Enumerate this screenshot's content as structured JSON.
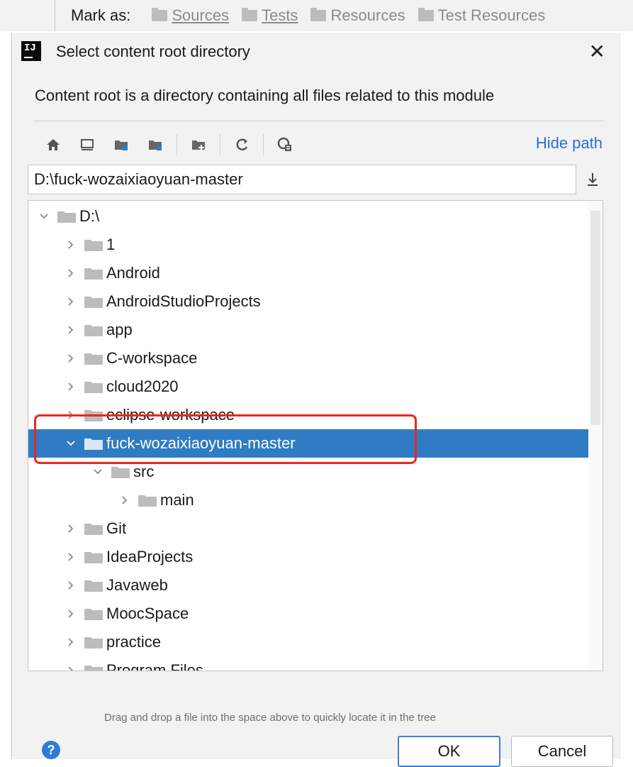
{
  "mark_bar": {
    "label": "Mark as:",
    "items": [
      {
        "label": "Sources",
        "icon": "sources-folder-icon"
      },
      {
        "label": "Tests",
        "icon": "tests-folder-icon"
      },
      {
        "label": "Resources",
        "icon": "resources-folder-icon"
      },
      {
        "label": "Test Resources",
        "icon": "test-resources-folder-icon"
      }
    ]
  },
  "dialog": {
    "title": "Select content root directory",
    "description": "Content root is a directory containing all files related to this module",
    "hide_path_label": "Hide path",
    "path_value": "D:\\fuck-wozaixiaoyuan-master",
    "hint": "Drag and drop a file into the space above to quickly locate it in the tree",
    "ok_label": "OK",
    "cancel_label": "Cancel",
    "help_label": "?"
  },
  "toolbar": {
    "buttons": [
      "home-icon",
      "desktop-icon",
      "project-folder-icon",
      "module-folder-icon",
      "new-folder-icon",
      "refresh-icon",
      "show-hidden-icon"
    ]
  },
  "tree": {
    "rows": [
      {
        "label": "D:\\",
        "expanded": true,
        "level": 0
      },
      {
        "label": "1",
        "expanded": false,
        "level": 1
      },
      {
        "label": "Android",
        "expanded": false,
        "level": 1
      },
      {
        "label": "AndroidStudioProjects",
        "expanded": false,
        "level": 1
      },
      {
        "label": "app",
        "expanded": false,
        "level": 1
      },
      {
        "label": "C-workspace",
        "expanded": false,
        "level": 1
      },
      {
        "label": "cloud2020",
        "expanded": false,
        "level": 1
      },
      {
        "label": "eclipse-workspace",
        "expanded": false,
        "level": 1
      },
      {
        "label": "fuck-wozaixiaoyuan-master",
        "expanded": true,
        "level": 1,
        "selected": true
      },
      {
        "label": "src",
        "expanded": true,
        "level": 2
      },
      {
        "label": "main",
        "expanded": false,
        "level": 3
      },
      {
        "label": "Git",
        "expanded": false,
        "level": 1
      },
      {
        "label": "IdeaProjects",
        "expanded": false,
        "level": 1
      },
      {
        "label": "Javaweb",
        "expanded": false,
        "level": 1
      },
      {
        "label": "MoocSpace",
        "expanded": false,
        "level": 1
      },
      {
        "label": "practice",
        "expanded": false,
        "level": 1
      },
      {
        "label": "Program Files",
        "expanded": false,
        "level": 1
      }
    ]
  },
  "colors": {
    "selection": "#2f7bc4",
    "link": "#2b6fd1",
    "highlight_box": "#e8281f",
    "folder": "#bcbcbc"
  }
}
